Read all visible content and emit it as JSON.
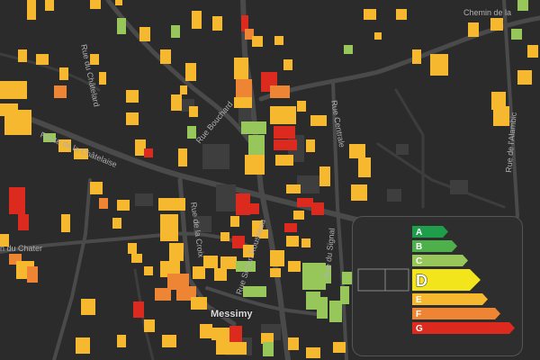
{
  "map": {
    "place_label": "Messimy",
    "street_labels": {
      "chemin_de_la": "Chemin de la",
      "rue_du_chatelard": "Rue du Châtelard",
      "route_de_la_chatelaise": "Route de la Châtelaise",
      "rue_bouchard": "Rue Bouchard",
      "rue_centrale": "Rue Centrale",
      "rue_de_l_alambic": "Rue de l'Alambic",
      "rue_simon_rousseau": "Rue Simon Rousseau",
      "rue_de_la_croix": "Rue de la Croix",
      "rue_du_signal": "Rue du Signal",
      "n_du_chater": "n du Chater"
    },
    "colors": {
      "background": "#2b2b2b",
      "A": "#1e9e4a",
      "B": "#4db04a",
      "C": "#97c75a",
      "D": "#f2e51c",
      "E": "#f5b82e",
      "F": "#ee8534",
      "G": "#dc2a1f"
    }
  },
  "legend": {
    "classes": [
      "A",
      "B",
      "C",
      "D",
      "E",
      "F",
      "G"
    ],
    "selected": "D"
  }
}
